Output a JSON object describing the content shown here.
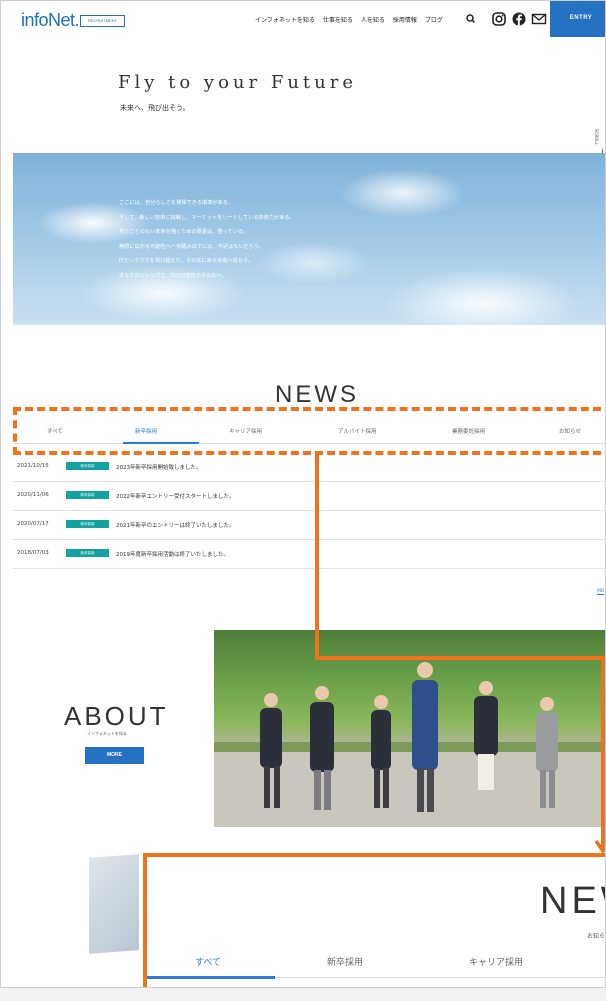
{
  "header": {
    "logo": "infoNet.",
    "badge": "RECRUITMENT",
    "nav": [
      "インフォネットを知る",
      "仕事を知る",
      "人を知る",
      "採用情報",
      "ブログ"
    ],
    "icons": [
      "search-icon",
      "instagram-icon",
      "facebook-icon",
      "mail-icon"
    ],
    "entry": "ENTRY"
  },
  "hero": {
    "title": "Fly to your Future",
    "subtitle": "未来へ、飛び出そう。",
    "scroll": "SCROLL",
    "lines": [
      "ここには、自分らしさを発揮できる環境がある。",
      "そして、新しい技術に挑戦し、マーケットをリードしている技術力がある。",
      "見たことのない未来を描くための要素は、整っている。",
      "無限に広がる可能性へ一歩踏み出すには、不足はないだろう。",
      "ITというワクを飛び越えた、その先にある未来へ進もう。",
      "あなたのジャンプで、ITの可能性のその先へ。"
    ]
  },
  "news": {
    "title": "NEWS",
    "tabs": [
      "すべて",
      "新卒採用",
      "キャリア採用",
      "アルバイト採用",
      "業務委託採用",
      "お知らせ"
    ],
    "items": [
      {
        "date": "2021/10/15",
        "tag": "新卒採用",
        "text": "2023年新卒採用開始致しました。"
      },
      {
        "date": "2020/11/06",
        "tag": "新卒採用",
        "text": "2022年新卒エントリー受付スタートしました。"
      },
      {
        "date": "2020/07/17",
        "tag": "新卒採用",
        "text": "2021年新卒のエントリーは終了いたしました。"
      },
      {
        "date": "2018/07/03",
        "tag": "新卒採用",
        "text": "2019年度新卒採用活動は終了いたしました。"
      }
    ],
    "more": "MO"
  },
  "about": {
    "title": "ABOUT",
    "subtitle": "インフォネットを知る",
    "more": "MORE"
  },
  "zoom": {
    "title": "NEW",
    "subtitle": "お知ら",
    "tabs": [
      "すべて",
      "新卒採用",
      "キャリア採用"
    ]
  },
  "colors": {
    "accent": "#2572c5",
    "highlight": "#f07219",
    "tag": "#12a3a0"
  }
}
